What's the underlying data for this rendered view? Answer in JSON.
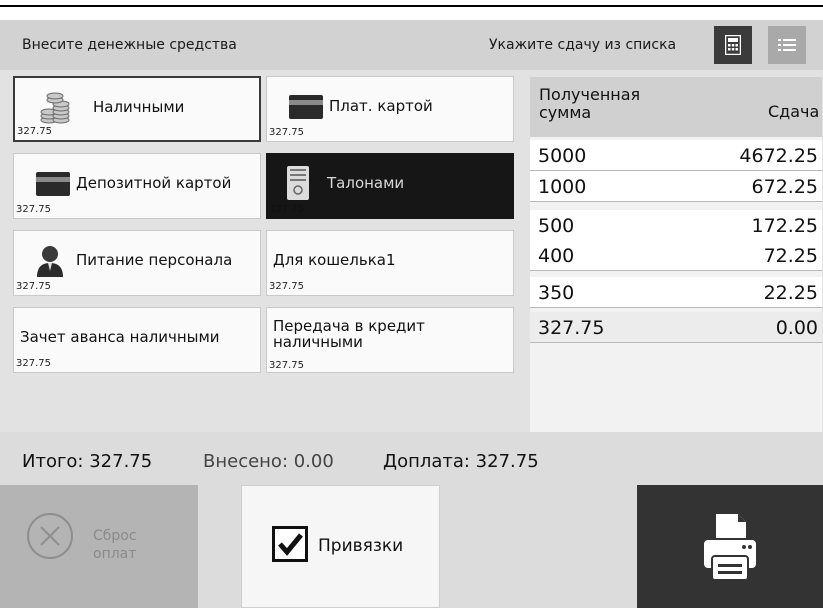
{
  "header": {
    "title": "Внесите денежные средства",
    "change_hint": "Укажите сдачу из списка",
    "calc_icon": "calculator-icon",
    "list_icon": "list-icon"
  },
  "payment_methods": [
    {
      "label": "Наличными",
      "amount": "327.75",
      "icon": "coins-icon",
      "state": "selected"
    },
    {
      "label": "Плат. картой",
      "amount": "327.75",
      "icon": "credit-card-icon"
    },
    {
      "label": "Депозитной картой",
      "amount": "327.75",
      "icon": "credit-card-icon"
    },
    {
      "label": "Талонами",
      "amount": "327.75",
      "icon": "coupon-icon",
      "state": "active"
    },
    {
      "label": "Питание персонала",
      "amount": "327.75",
      "icon": "person-icon"
    },
    {
      "label": "Для кошелька1",
      "amount": "327.75"
    },
    {
      "label": "Зачет аванса наличными",
      "amount": "327.75"
    },
    {
      "label": "Передача в кредит наличными",
      "amount": "327.75"
    }
  ],
  "change_table": {
    "col_received": "Полученная сумма",
    "col_change": "Сдача",
    "rows": [
      {
        "received": "5000",
        "change": "4672.25"
      },
      {
        "received": "1000",
        "change": "672.25"
      },
      {
        "received": "500",
        "change": "172.25"
      },
      {
        "received": "400",
        "change": "72.25"
      },
      {
        "received": "350",
        "change": "22.25"
      },
      {
        "received": "327.75",
        "change": "0.00"
      }
    ]
  },
  "totals": {
    "total": "Итого: 327.75",
    "paid": "Внесено: 0.00",
    "due": "Доплата: 327.75"
  },
  "actions": {
    "reset_line1": "Сброс",
    "reset_line2": "оплат",
    "bindings_label": "Привязки",
    "bindings_checked": true,
    "print_icon": "printer-icon"
  },
  "colors": {
    "header_bg": "#d2d2d2",
    "active_tile": "#161616",
    "print_button": "#333333"
  }
}
